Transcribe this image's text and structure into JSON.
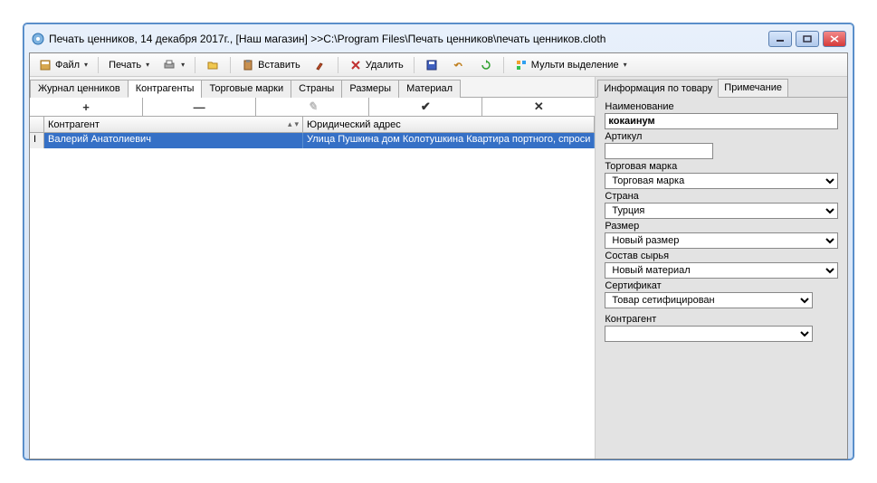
{
  "window": {
    "title": "Печать ценников, 14 декабря 2017г., [Наш магазин] >>C:\\Program Files\\Печать ценников\\печать ценников.cloth"
  },
  "toolbar": {
    "file": "Файл",
    "print": "Печать",
    "paste": "Вставить",
    "delete": "Удалить",
    "multi": "Мульти выделение"
  },
  "tabs": [
    {
      "label": "Журнал ценников",
      "active": false
    },
    {
      "label": "Контрагенты",
      "active": true
    },
    {
      "label": "Торговые марки",
      "active": false
    },
    {
      "label": "Страны",
      "active": false
    },
    {
      "label": "Размеры",
      "active": false
    },
    {
      "label": "Материал",
      "active": false
    }
  ],
  "nav": {
    "add": "+",
    "remove": "—",
    "edit": "✎",
    "apply": "✔",
    "cancel": "✕"
  },
  "grid": {
    "cols": [
      "Контрагент",
      "Юридический адрес"
    ],
    "rows": [
      {
        "indicator": "I",
        "name": "Валерий Анатолиевич",
        "addr": "Улица Пушкина дом Колотушкина Квартира портного, спроси"
      }
    ]
  },
  "right_tabs": [
    {
      "label": "Информация по товару",
      "active": true
    },
    {
      "label": "Примечание",
      "active": false
    }
  ],
  "form": {
    "name": {
      "label": "Наименование",
      "value": "кокаинум"
    },
    "sku": {
      "label": "Артикул",
      "value": ""
    },
    "brand": {
      "label": "Торговая марка",
      "value": "Торговая марка"
    },
    "country": {
      "label": "Страна",
      "value": "Турция"
    },
    "size": {
      "label": "Размер",
      "value": "Новый размер"
    },
    "material": {
      "label": "Состав сырья",
      "value": "Новый материал"
    },
    "cert": {
      "label": "Сертификат",
      "value": "Товар сетифицирован"
    },
    "counterparty": {
      "label": "Контрагент",
      "value": ""
    }
  }
}
